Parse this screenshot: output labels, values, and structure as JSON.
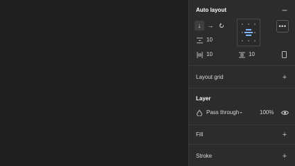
{
  "auto_layout": {
    "title": "Auto layout",
    "collapse_icon": "minus-icon",
    "direction_vertical_icon": "arrow-down-icon",
    "direction_horizontal_icon": "arrow-right-icon",
    "wrap_icon": "wrap-icon",
    "gap_value": "10",
    "padding_horizontal_value": "10",
    "padding_vertical_value": "10",
    "more_icon": "more-icon",
    "clip_icon": "clip-content-icon"
  },
  "layout_grid": {
    "title": "Layout grid",
    "add_icon": "plus-icon"
  },
  "layer": {
    "title": "Layer",
    "blend_mode": "Pass through",
    "opacity": "100%",
    "visibility_icon": "eye-icon"
  },
  "fill": {
    "title": "Fill",
    "add_icon": "plus-icon"
  },
  "stroke": {
    "title": "Stroke",
    "add_icon": "plus-icon"
  },
  "colors": {
    "canvas": "#1e1e1e",
    "panel": "#2c2c2c",
    "accent": "#7fb6ff"
  }
}
